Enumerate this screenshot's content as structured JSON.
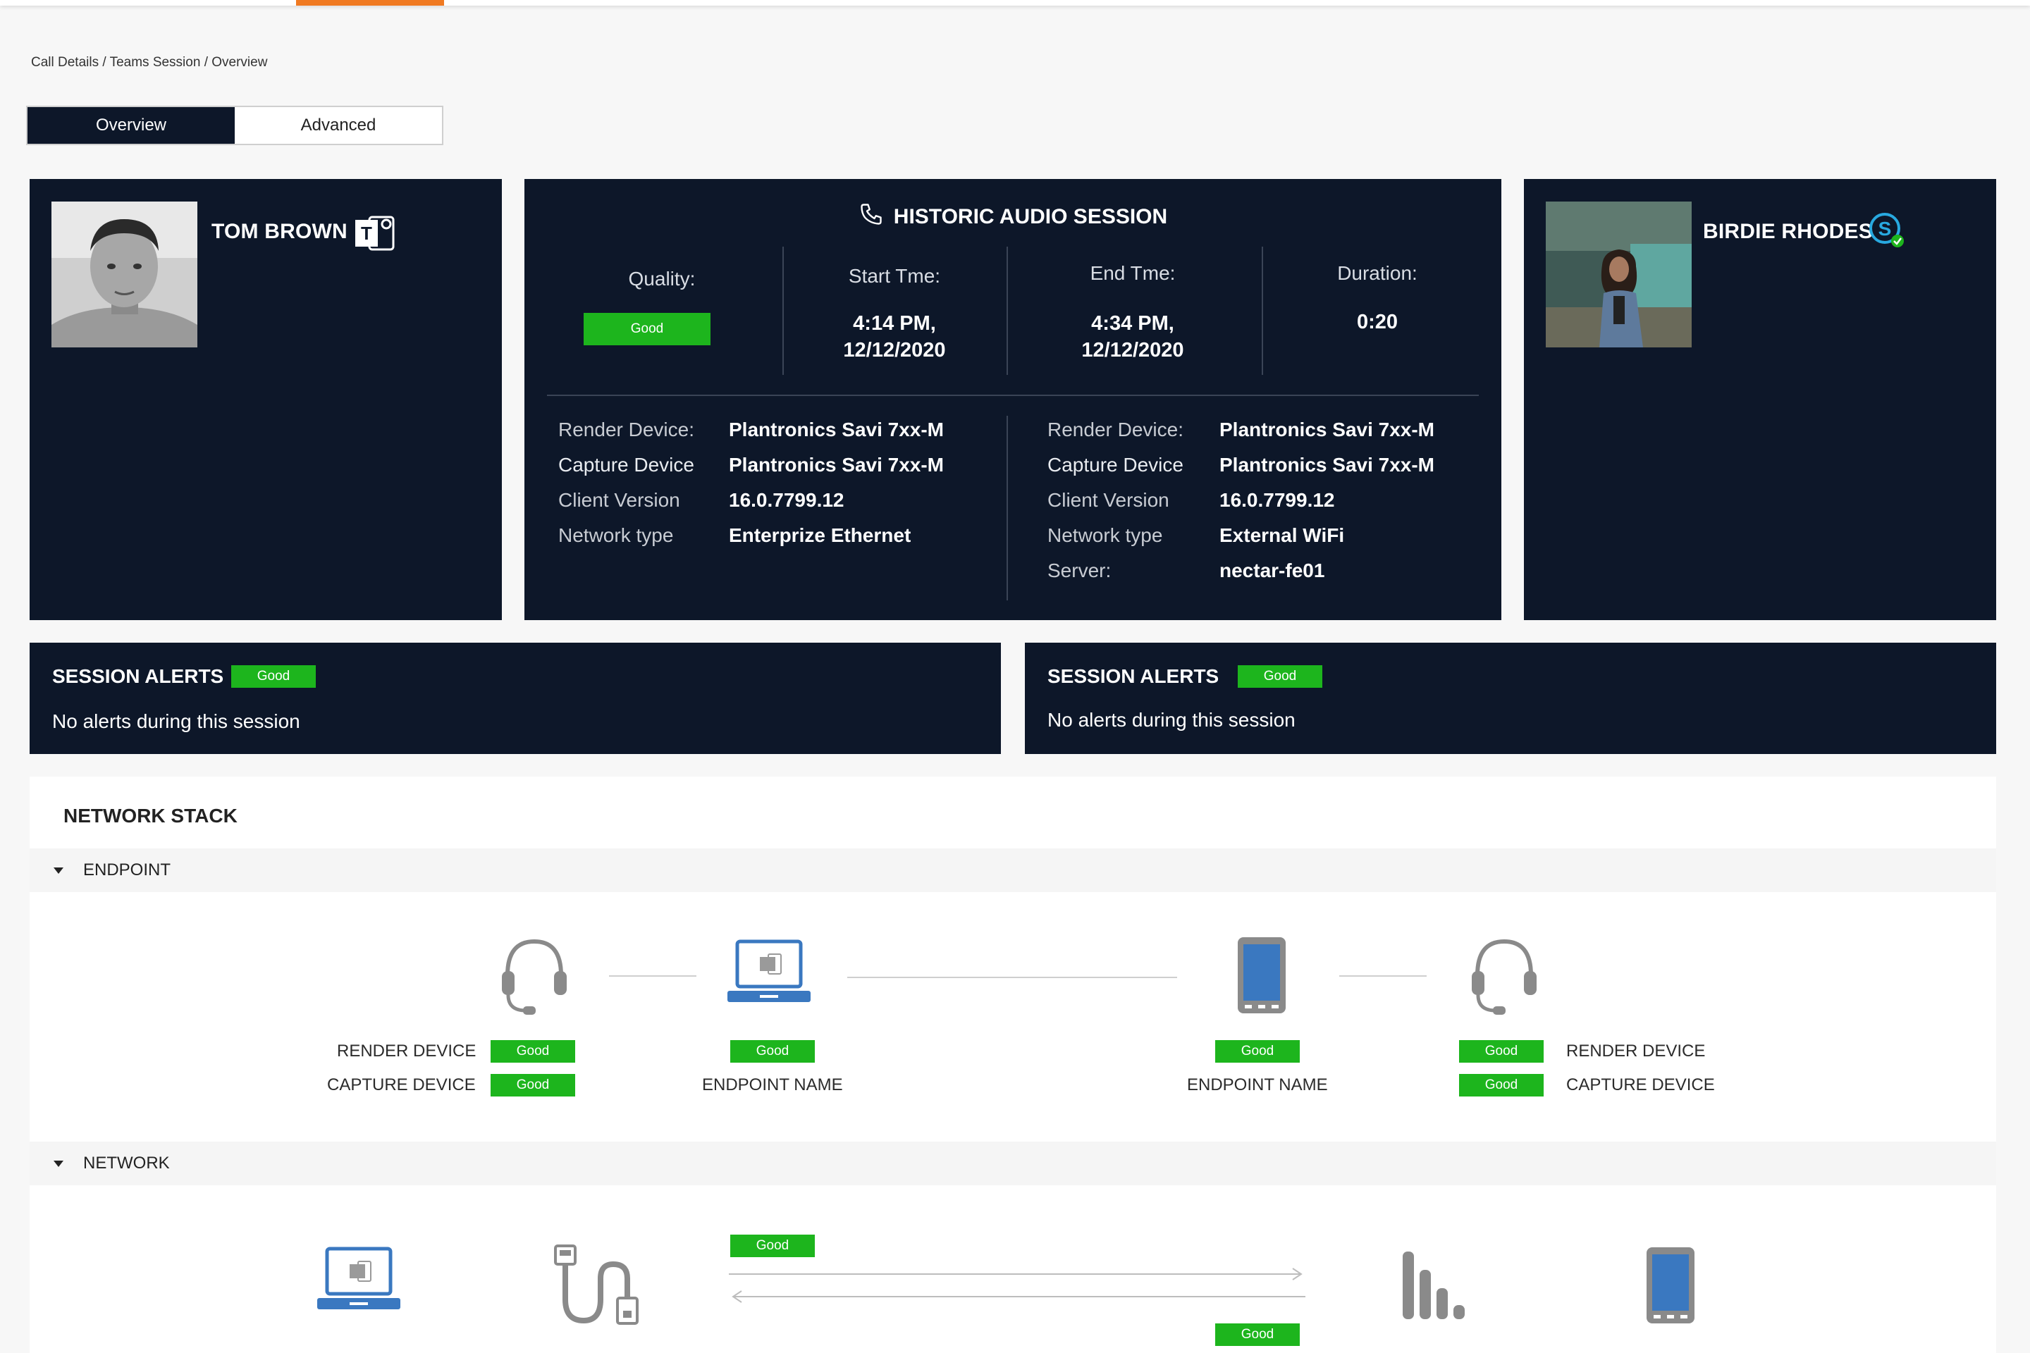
{
  "breadcrumb": "Call Details / Teams Session / Overview",
  "tabs": {
    "overview": "Overview",
    "advanced": "Advanced"
  },
  "left_user": {
    "name": "TOM BROWN",
    "app_icon": "teams-icon"
  },
  "right_user": {
    "name": "BIRDIE RHODES",
    "app_icon": "skype-icon"
  },
  "session": {
    "title": "HISTORIC AUDIO SESSION",
    "quality_label": "Quality:",
    "quality_value": "Good",
    "start_label": "Start Tme:",
    "start_time": "4:14 PM,",
    "start_date": "12/12/2020",
    "end_label": "End Tme:",
    "end_time": "4:34 PM,",
    "end_date": "12/12/2020",
    "duration_label": "Duration:",
    "duration_value": "0:20",
    "left": {
      "render_label": "Render Device:",
      "render_value": "Plantronics Savi 7xx-M",
      "capture_label": "Capture Device",
      "capture_value": "Plantronics Savi 7xx-M",
      "client_label": "Client Version",
      "client_value": "16.0.7799.12",
      "network_label": "Network type",
      "network_value": "Enterprize Ethernet"
    },
    "right": {
      "render_label": "Render Device:",
      "render_value": "Plantronics Savi 7xx-M",
      "capture_label": "Capture Device",
      "capture_value": "Plantronics Savi 7xx-M",
      "client_label": "Client Version",
      "client_value": "16.0.7799.12",
      "network_label": "Network type",
      "network_value": "External WiFi",
      "server_label": "Server:",
      "server_value": "nectar-fe01"
    }
  },
  "alerts": [
    {
      "title": "SESSION ALERTS",
      "status": "Good",
      "message": "No alerts during this session"
    },
    {
      "title": "SESSION ALERTS",
      "status": "Good",
      "message": "No alerts during this session"
    }
  ],
  "network_stack": {
    "title": "NETWORK STACK",
    "endpoint_section": "ENDPOINT",
    "network_section": "NETWORK",
    "left_render_label": "RENDER DEVICE",
    "left_capture_label": "CAPTURE DEVICE",
    "left_render_status": "Good",
    "left_capture_status": "Good",
    "left_endpoint_status": "Good",
    "left_endpoint_label": "ENDPOINT NAME",
    "right_endpoint_status": "Good",
    "right_endpoint_label": "ENDPOINT NAME",
    "right_render_status": "Good",
    "right_capture_status": "Good",
    "right_render_label": "RENDER DEVICE",
    "right_capture_label": "CAPTURE DEVICE",
    "upstream_status": "Good",
    "downstream_status": "Good"
  },
  "colors": {
    "panel": "#0d1729",
    "good": "#1db51d",
    "accent": "#f07a22",
    "icon_blue": "#3a78c0",
    "icon_gray": "#8a8a8a"
  }
}
